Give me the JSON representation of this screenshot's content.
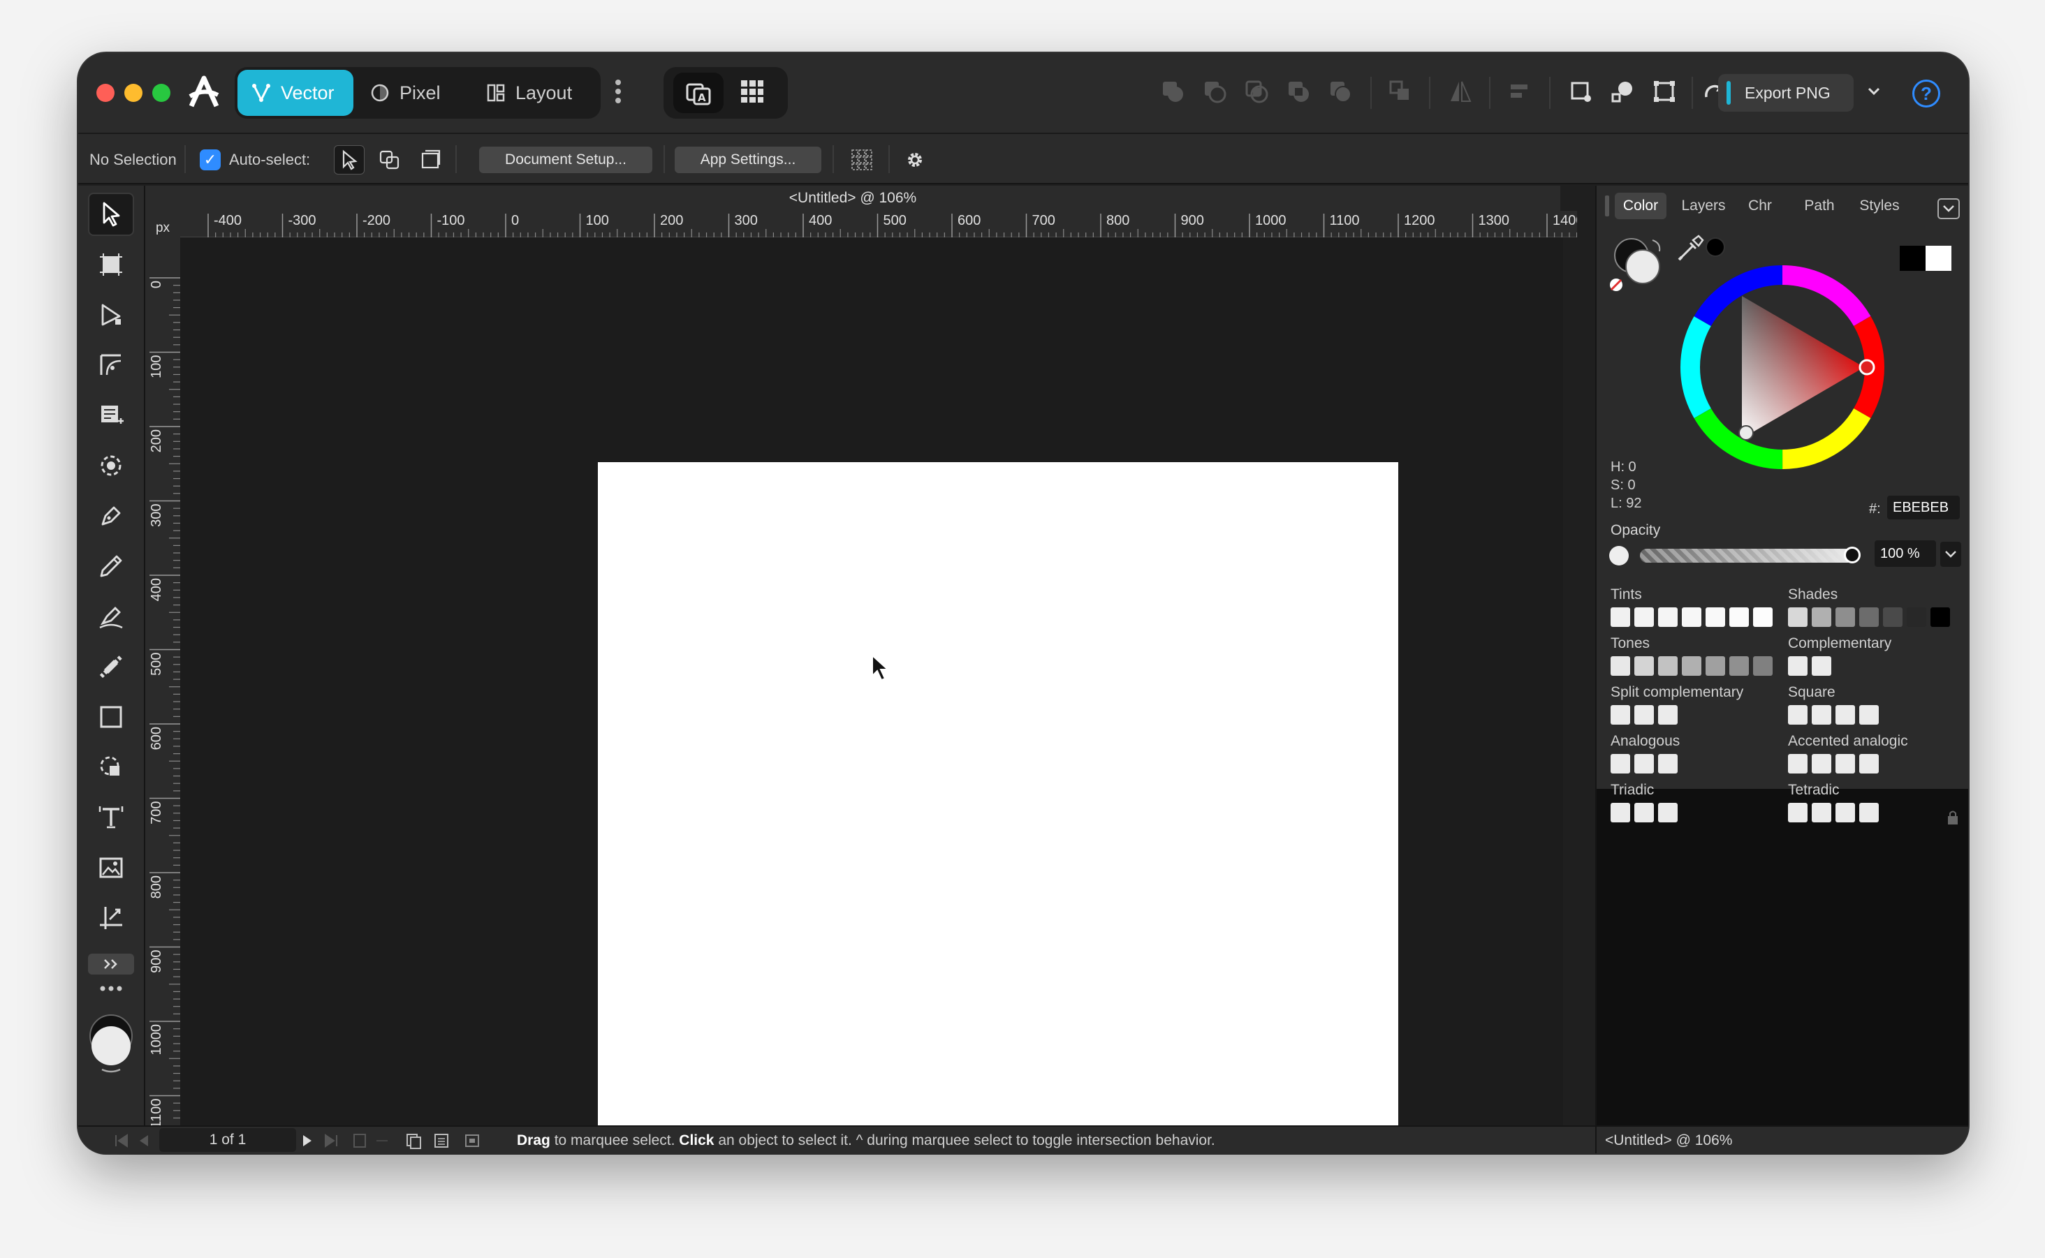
{
  "personas": [
    {
      "label": "Vector",
      "active": true
    },
    {
      "label": "Pixel",
      "active": false
    },
    {
      "label": "Layout",
      "active": false
    }
  ],
  "toolbar": {
    "export_label": "Export PNG",
    "help_label": "?"
  },
  "context": {
    "selection": "No Selection",
    "auto_select": "Auto-select:",
    "document_setup": "Document Setup...",
    "app_settings": "App Settings..."
  },
  "document": {
    "title": "<Untitled> @ 106%"
  },
  "ruler": {
    "unit": "px",
    "h_ticks": [
      "-400",
      "-300",
      "-200",
      "-100",
      "0",
      "100",
      "200",
      "300",
      "400",
      "500",
      "600",
      "700",
      "800",
      "900",
      "1000",
      "1100",
      "1200",
      "1300",
      "1400"
    ],
    "v_ticks": [
      "0",
      "100",
      "200",
      "300",
      "400",
      "500",
      "600",
      "700",
      "800",
      "900",
      "1000",
      "1100"
    ]
  },
  "panel": {
    "tabs": [
      "Color",
      "Layers",
      "Chr",
      "Path",
      "Styles"
    ],
    "active_tab": "Color",
    "h": "H: 0",
    "s": "S: 0",
    "l": "L: 92",
    "hex_label": "#:",
    "hex": "EBEBEB",
    "opacity_label": "Opacity",
    "opacity": "100 %",
    "harmonies": [
      {
        "label": "Tints",
        "colors": [
          "#f0f0f0",
          "#f3f3f3",
          "#f5f5f5",
          "#f7f7f7",
          "#f9f9f9",
          "#fbfbfb",
          "#fdfdfd"
        ]
      },
      {
        "label": "Shades",
        "colors": [
          "#d8d8d8",
          "#b0b0b0",
          "#8e8e8e",
          "#6c6c6c",
          "#4a4a4a",
          "#282828",
          "#000000"
        ]
      },
      {
        "label": "Tones",
        "colors": [
          "#e8e8e8",
          "#d4d4d4",
          "#c2c2c2",
          "#b0b0b0",
          "#a0a0a0",
          "#909090",
          "#808080"
        ]
      },
      {
        "label": "Complementary",
        "colors": [
          "#ebebeb",
          "#ebebeb"
        ]
      },
      {
        "label": "Split complementary",
        "colors": [
          "#ebebeb",
          "#ebebeb",
          "#ebebeb"
        ]
      },
      {
        "label": "Square",
        "colors": [
          "#ebebeb",
          "#ebebeb",
          "#ebebeb",
          "#ebebeb"
        ]
      },
      {
        "label": "Analogous",
        "colors": [
          "#ebebeb",
          "#ebebeb",
          "#ebebeb"
        ]
      },
      {
        "label": "Accented analogic",
        "colors": [
          "#ebebeb",
          "#ebebeb",
          "#ebebeb",
          "#ebebeb"
        ]
      },
      {
        "label": "Triadic",
        "colors": [
          "#ebebeb",
          "#ebebeb",
          "#ebebeb"
        ]
      },
      {
        "label": "Tetradic",
        "colors": [
          "#ebebeb",
          "#ebebeb",
          "#ebebeb",
          "#ebebeb"
        ]
      }
    ]
  },
  "status": {
    "page": "1 of 1",
    "hint_drag": "Drag",
    "hint_1": " to marquee select. ",
    "hint_click": "Click",
    "hint_2": " an object to select it. ^ during marquee select to toggle intersection behavior.",
    "right": "<Untitled> @ 106%"
  },
  "colors": {
    "accent": "#1fb6d6",
    "help": "#2f8cff",
    "bg": "#2b2b2b"
  }
}
